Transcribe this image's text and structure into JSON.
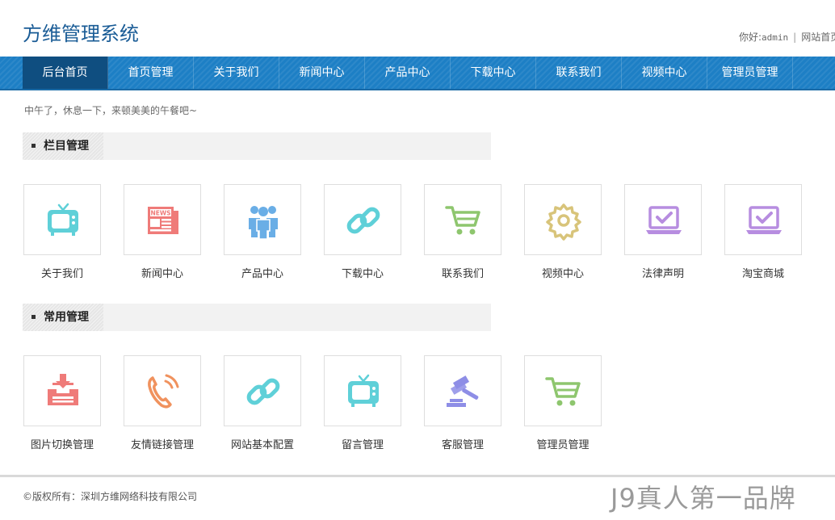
{
  "header": {
    "logo": "方维管理系统",
    "greeting_prefix": "你好:",
    "username": "admin",
    "separator": "|",
    "site_home_link": "网站首页"
  },
  "nav": {
    "items": [
      "后台首页",
      "首页管理",
      "关于我们",
      "新闻中心",
      "产品中心",
      "下载中心",
      "联系我们",
      "视频中心",
      "管理员管理"
    ],
    "active_index": 0
  },
  "greeting": "中午了，休息一下，来顿美美的午餐吧~",
  "sections": [
    {
      "title": "栏目管理",
      "items": [
        {
          "label": "关于我们",
          "icon": "tv-icon",
          "color": "#5fd0d8"
        },
        {
          "label": "新闻中心",
          "icon": "newspaper-icon",
          "color": "#ef7b79"
        },
        {
          "label": "产品中心",
          "icon": "users-group-icon",
          "color": "#6aaee6"
        },
        {
          "label": "下载中心",
          "icon": "link-icon",
          "color": "#5fd0d8"
        },
        {
          "label": "联系我们",
          "icon": "cart-icon",
          "color": "#8ec66e"
        },
        {
          "label": "视频中心",
          "icon": "gear-icon",
          "color": "#d8c47a"
        },
        {
          "label": "法律声明",
          "icon": "laptop-check-icon",
          "color": "#b78de0"
        },
        {
          "label": "淘宝商城",
          "icon": "laptop-check-icon",
          "color": "#b78de0"
        }
      ]
    },
    {
      "title": "常用管理",
      "items": [
        {
          "label": "图片切换管理",
          "icon": "inbox-download-icon",
          "color": "#ef7b79"
        },
        {
          "label": "友情链接管理",
          "icon": "phone-icon",
          "color": "#f0925e"
        },
        {
          "label": "网站基本配置",
          "icon": "link-icon",
          "color": "#5fd0d8"
        },
        {
          "label": "留言管理",
          "icon": "tv-icon",
          "color": "#5fd0d8"
        },
        {
          "label": "客服管理",
          "icon": "gavel-icon",
          "color": "#8e8ee6"
        },
        {
          "label": "管理员管理",
          "icon": "cart-icon",
          "color": "#8ec66e"
        }
      ]
    }
  ],
  "footer": {
    "copyright": "©版权所有：深圳方维网络科技有限公司"
  },
  "watermark": "J9真人第一品牌",
  "colors": {
    "nav_bg": "#1d7fc5",
    "nav_active": "#0f4e80",
    "logo": "#1a5c96"
  }
}
